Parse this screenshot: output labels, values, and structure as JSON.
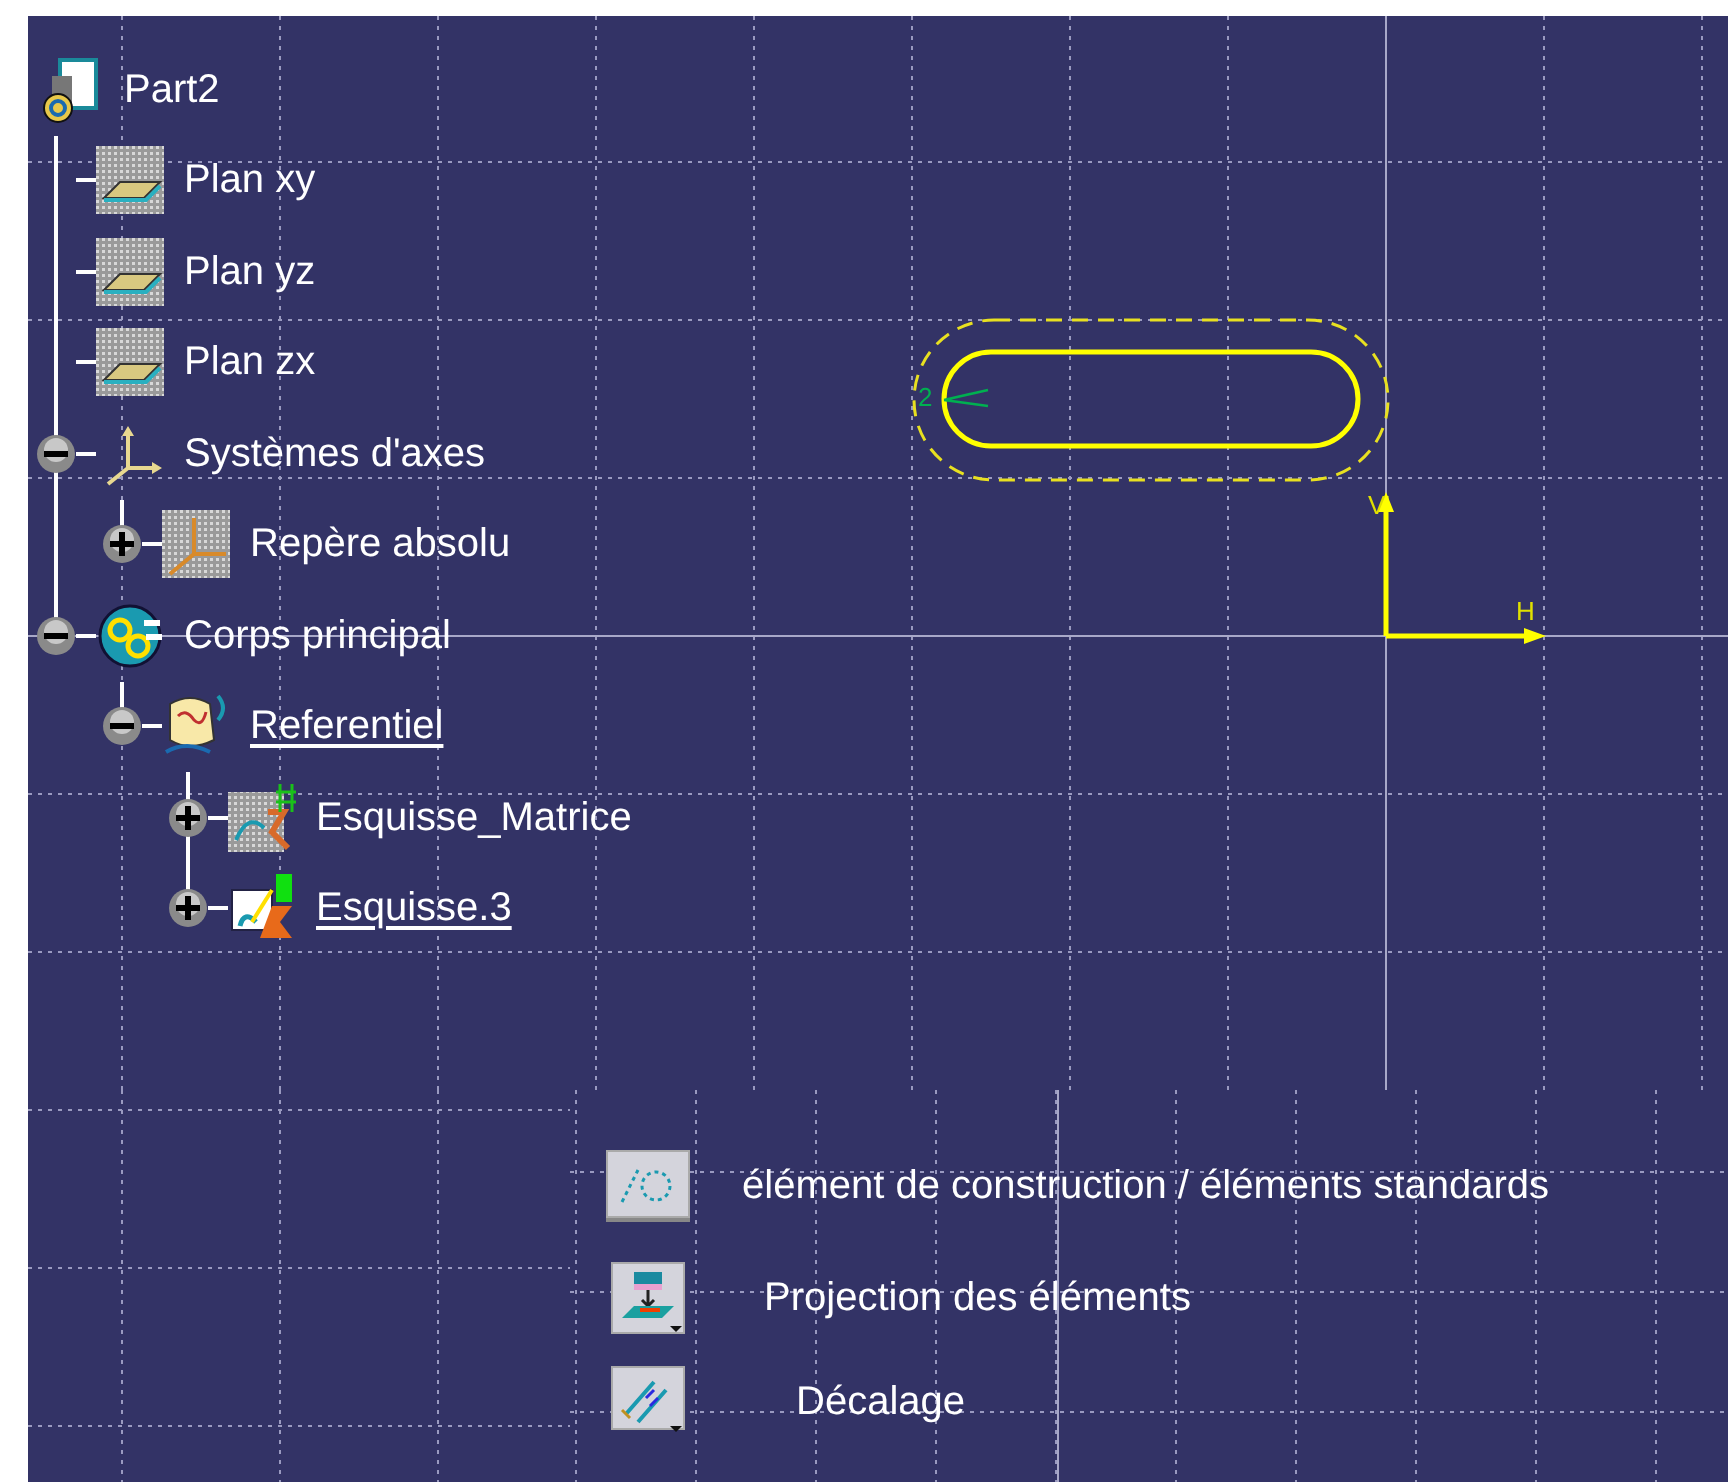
{
  "tree": {
    "label": "Part2",
    "kind": "part",
    "active": false,
    "children": [
      {
        "label": "Plan xy",
        "kind": "plane",
        "active": false
      },
      {
        "label": "Plan yz",
        "kind": "plane",
        "active": false
      },
      {
        "label": "Plan zx",
        "kind": "plane",
        "active": false
      },
      {
        "label": "Systèmes d'axes",
        "kind": "axis-set",
        "active": false,
        "expanded": true,
        "children": [
          {
            "label": "Repère absolu",
            "kind": "axis-system",
            "active": false,
            "expanded": false
          }
        ]
      },
      {
        "label": "Corps principal",
        "kind": "body",
        "active": false,
        "expanded": true,
        "children": [
          {
            "label": "Referentiel",
            "kind": "geometrical-set",
            "active": true,
            "expanded": true,
            "children": [
              {
                "label": "Esquisse_Matrice",
                "kind": "sketch",
                "active": false,
                "expanded": false
              },
              {
                "label": "Esquisse.3",
                "kind": "active-sketch",
                "active": true,
                "expanded": false
              }
            ]
          }
        ]
      }
    ]
  },
  "sketch": {
    "dimension": "2",
    "v_axis": "V",
    "h_axis": "H"
  },
  "legend": [
    {
      "kind": "construction",
      "label": "élément de construction / éléments standards"
    },
    {
      "kind": "projection",
      "label": "Projection des éléments"
    },
    {
      "kind": "offset",
      "label": "Décalage"
    }
  ]
}
